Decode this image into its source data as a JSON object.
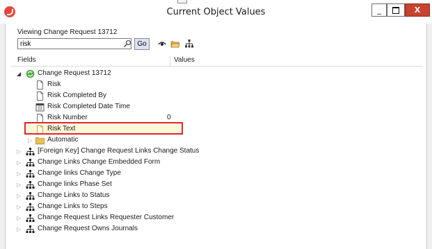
{
  "window": {
    "title": "Current Object Values",
    "controls": {
      "minimize": "_",
      "close": "X"
    }
  },
  "viewing_label": "Viewing Change Request 13712",
  "search": {
    "value": "risk",
    "go_label": "Go"
  },
  "columns": {
    "fields": "Fields",
    "values": "Values"
  },
  "tree": {
    "root": {
      "label": "Change Request 13712",
      "icon": "change-request-icon"
    },
    "children": [
      {
        "label": "Risk",
        "icon": "document-icon",
        "value": ""
      },
      {
        "label": "Risk Completed By",
        "icon": "document-icon",
        "value": ""
      },
      {
        "label": "Risk Completed Date Time",
        "icon": "calendar-icon",
        "value": ""
      },
      {
        "label": "Risk Number",
        "icon": "document-icon",
        "value": "0"
      },
      {
        "label": "Risk Text",
        "icon": "document-icon",
        "value": "",
        "highlighted": true
      },
      {
        "label": "Automatic",
        "icon": "folder-icon",
        "value": ""
      }
    ],
    "relations": [
      "[Foreign Key] Change Request Links Change Status",
      "Change Links Change Embedded Form",
      "Change links Change Type",
      "Change links Phase Set",
      "Change Links to Status",
      "Change Links to Steps",
      "Change Request Links Requester Customer",
      "Change Request Owns Journals"
    ]
  },
  "colors": {
    "highlight_border": "#e2231a",
    "close_button": "#c7422f"
  }
}
